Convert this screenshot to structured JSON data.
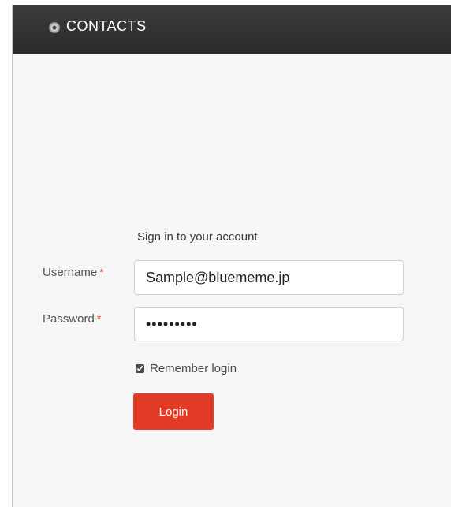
{
  "app": {
    "title": "CONTACTS",
    "logo_icon": "circle-logo-icon"
  },
  "login": {
    "heading": "Sign in to your account",
    "username_label": "Username",
    "username_value": "Sample@bluememe.jp",
    "password_label": "Password",
    "password_value": "•••••••••",
    "required_marker": "*",
    "remember_label": "Remember login",
    "remember_checked": true,
    "login_button_label": "Login"
  },
  "colors": {
    "header_bg": "#333333",
    "accent": "#e23b25",
    "required": "#e0402a",
    "page_bg": "#f6f6f6"
  }
}
